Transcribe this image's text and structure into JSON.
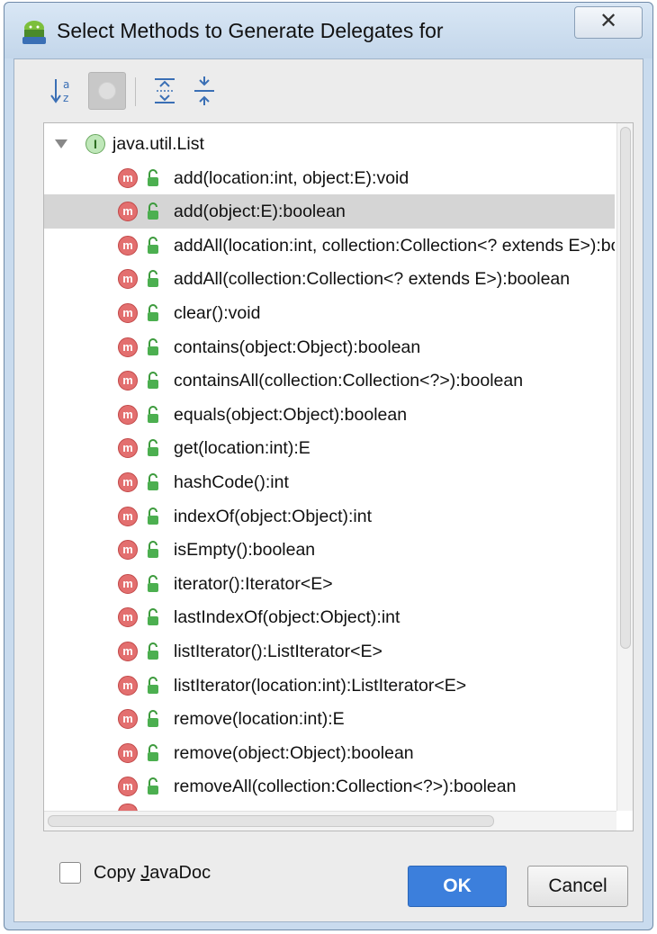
{
  "window": {
    "title": "Select Methods to Generate Delegates for",
    "close_glyph": "✕"
  },
  "toolbar": {
    "buttons": [
      {
        "icon": "sort-alphabetically-icon"
      },
      {
        "icon": "show-classes-icon",
        "state": "pressed"
      },
      {
        "icon": "expand-all-icon"
      },
      {
        "icon": "collapse-all-icon"
      }
    ]
  },
  "tree": {
    "root": {
      "badge": "I",
      "label": "java.util.List"
    },
    "method_badge": "m",
    "methods": [
      "add(location:int, object:E):void",
      "add(object:E):boolean",
      "addAll(location:int, collection:Collection<? extends E>):boolean",
      "addAll(collection:Collection<? extends E>):boolean",
      "clear():void",
      "contains(object:Object):boolean",
      "containsAll(collection:Collection<?>):boolean",
      "equals(object:Object):boolean",
      "get(location:int):E",
      "hashCode():int",
      "indexOf(object:Object):int",
      "isEmpty():boolean",
      "iterator():Iterator<E>",
      "lastIndexOf(object:Object):int",
      "listIterator():ListIterator<E>",
      "listIterator(location:int):ListIterator<E>",
      "remove(location:int):E",
      "remove(object:Object):boolean",
      "removeAll(collection:Collection<?>):boolean"
    ],
    "selected_method": "add(object:E):boolean"
  },
  "footer": {
    "copy_javadoc": {
      "label_pre": "Copy ",
      "label_mnemonic": "J",
      "label_post": "avaDoc",
      "checked": false
    },
    "ok_label": "OK",
    "cancel_label": "Cancel"
  },
  "colors": {
    "ok_button": "#3c7fdc",
    "method_badge": "#e36f6f",
    "interface_badge": "#bfe7b9",
    "selection": "#d5d5d5"
  }
}
